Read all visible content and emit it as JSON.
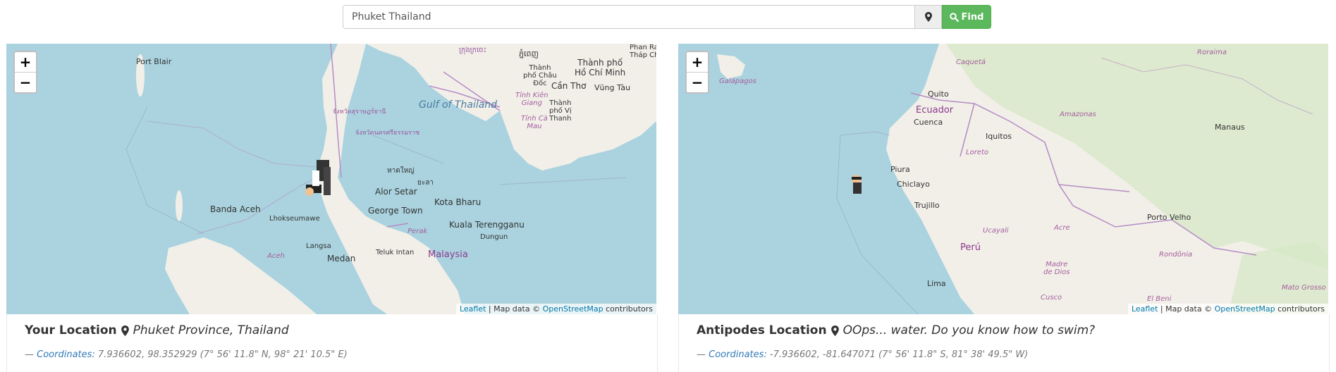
{
  "search": {
    "value": "Phuket Thailand",
    "find_label": "Find"
  },
  "left_map": {
    "zoom_in": "+",
    "zoom_out": "−",
    "labels": {
      "port_blair": "Port Blair",
      "gulf": "Gulf of Thailand",
      "hcmc": "Thành phố\nHồ Chí Minh",
      "phan_ra": "Phan Ra\nTháp Ch",
      "vung_tau": "Vũng Tàu",
      "can_tho": "Cần Thơ",
      "thanh_pho_chau_doc": "Thành\nphố Châu\nĐốc",
      "tinh_kien_giang": "Tỉnh Kiên\nGiang",
      "tinh_ca_mau": "Tỉnh Cà\nMau",
      "thanh_pho_vi_thanh": "Thành\nphố Vị\nThanh",
      "khmer1": "ក្រុងក្រចេះ",
      "khmer2": "ភ្នំពេញ",
      "thai1": "จังหวัดสุราษฎร์ธานี",
      "thai2": "จังหวัดนครศรีธรรมราช",
      "hat_yai": "หาดใหญ่",
      "yala": "ยะลา",
      "banda_aceh": "Banda Aceh",
      "lhokseumawe": "Lhokseumawe",
      "langsa": "Langsa",
      "medan": "Medan",
      "alor_setar": "Alor Setar",
      "george_town": "George Town",
      "kota_bharu": "Kota Bharu",
      "kuala_terengganu": "Kuala Terengganu",
      "dungun": "Dungun",
      "perak": "Perak",
      "teluk_intan": "Teluk Intan",
      "malaysia": "Malaysia",
      "aceh": "Aceh"
    },
    "attribution": {
      "leaflet": "Leaflet",
      "sep": " | Map data © ",
      "osm": "OpenStreetMap",
      "contrib": " contributors"
    }
  },
  "right_map": {
    "zoom_in": "+",
    "zoom_out": "−",
    "labels": {
      "galapagos": "Galápagos",
      "quito": "Quito",
      "ecuador": "Ecuador",
      "cuenca": "Cuenca",
      "caqueta": "Caquetá",
      "amazonas": "Amazonas",
      "roraima": "Roraima",
      "iquitos": "Iquitos",
      "manaus": "Manaus",
      "loreto": "Loreto",
      "piura": "Piura",
      "chiclayo": "Chiclayo",
      "trujillo": "Trujillo",
      "ucayali": "Ucayali",
      "acre": "Acre",
      "porto_velho": "Porto Velho",
      "peru": "Perú",
      "rondonia": "Rondônia",
      "madre_de_dios": "Madre\nde Dios",
      "lima": "Lima",
      "cusco": "Cusco",
      "el_beni": "El Beni",
      "mato_grosso": "Mato Grosso"
    },
    "attribution": {
      "leaflet": "Leaflet",
      "sep": " | Map data © ",
      "osm": "OpenStreetMap",
      "contrib": " contributors"
    }
  },
  "your_location": {
    "title": "Your Location",
    "place": "Phuket Province, Thailand",
    "dash": "— ",
    "coords_label": "Coordinates:",
    "coords_value": " 7.936602, 98.352929 (7° 56' 11.8\" N, 98° 21' 10.5\" E)"
  },
  "antipodes_location": {
    "title": "Antipodes Location",
    "place": "OOps... water. Do you know how to swim?",
    "dash": "— ",
    "coords_label": "Coordinates:",
    "coords_value": " -7.936602, -81.647071 (7° 56' 11.8\" S, 81° 38' 49.5\" W)"
  },
  "colors": {
    "water": "#aad3df",
    "land": "#f2efe9",
    "green_land": "#d7e8c8",
    "border": "#b58cc4",
    "find_button": "#5cb85c",
    "link": "#337ab7"
  }
}
